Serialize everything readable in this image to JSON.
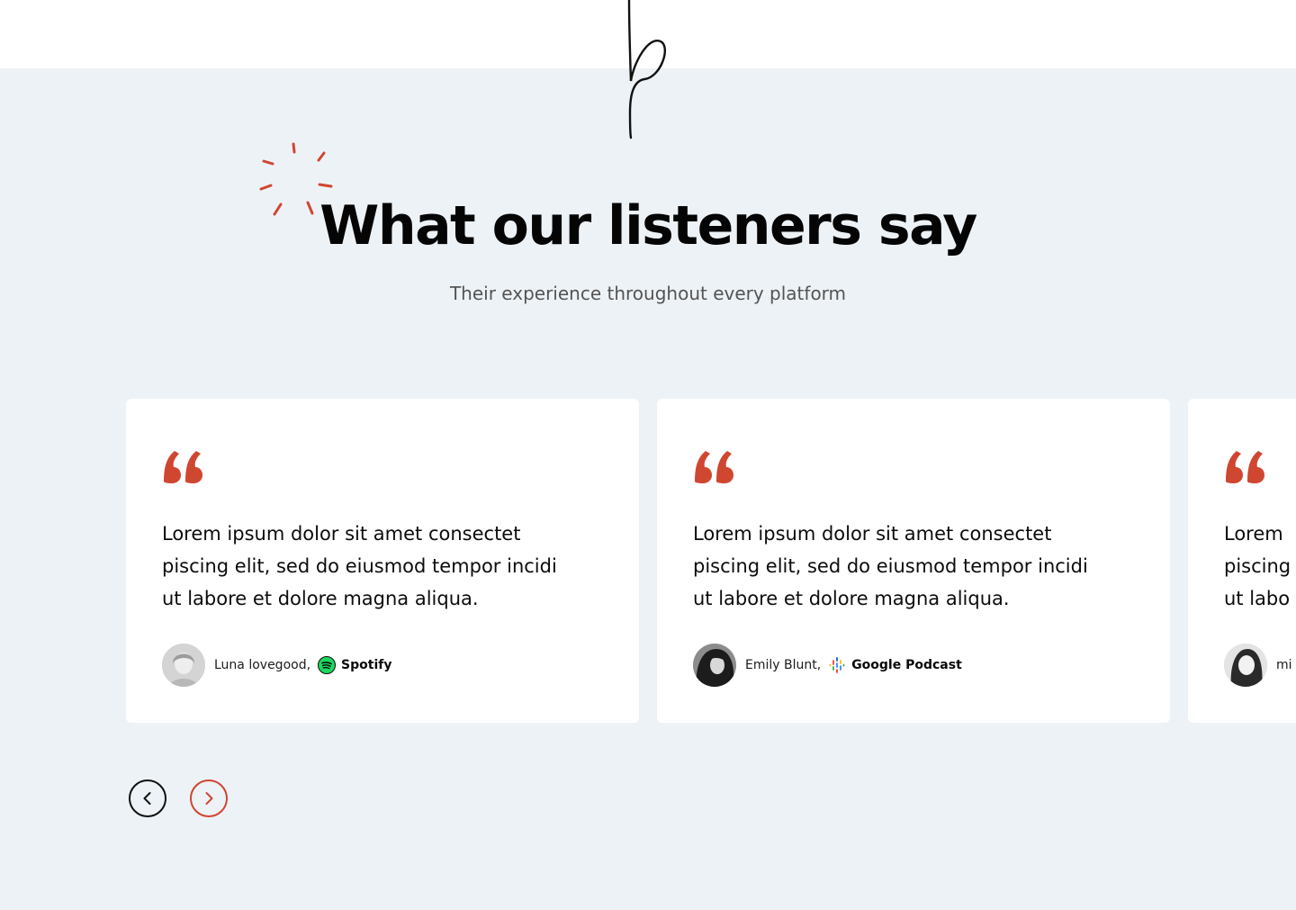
{
  "header": {
    "title": "What our listeners say",
    "subtitle": "Their experience throughout every platform"
  },
  "colors": {
    "accent": "#cf4631",
    "section_background": "#edf2f6",
    "card_background": "#ffffff",
    "spotify_green": "#1ed760"
  },
  "testimonials": [
    {
      "quote_lines": [
        "Lorem ipsum dolor sit amet consectet",
        "piscing elit, sed do eiusmod tempor incidi",
        "ut labore et dolore magna aliqua."
      ],
      "author": "Luna lovegood,",
      "platform": "Spotify",
      "platform_icon": "spotify-icon"
    },
    {
      "quote_lines": [
        "Lorem ipsum dolor sit amet consectet",
        "piscing elit, sed do eiusmod tempor incidi",
        "ut labore et dolore magna aliqua."
      ],
      "author": "Emily Blunt,",
      "platform": "Google Podcast",
      "platform_icon": "google-podcasts-icon"
    },
    {
      "quote_lines": [
        "Lorem",
        "piscing",
        "ut labo"
      ],
      "author": "mi",
      "platform": "",
      "platform_icon": ""
    }
  ],
  "navigation": {
    "prev_icon": "chevron-left-icon",
    "next_icon": "chevron-right-icon"
  }
}
